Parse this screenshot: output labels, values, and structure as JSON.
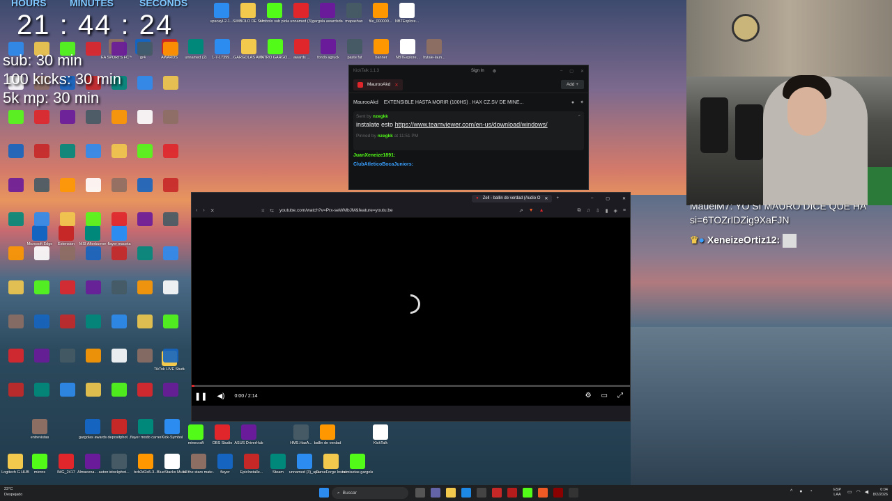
{
  "overlay": {
    "hours_label": "HOURS",
    "minutes_label": "MINUTES",
    "seconds_label": "SECONDS",
    "time": "21 : 44 : 24",
    "goals": [
      "sub: 30 min",
      "100 kicks: 30 min",
      "5k mp: 30 min"
    ]
  },
  "desktop_icons": [
    {
      "label": "upscayl-2-1..."
    },
    {
      "label": "SIMBOLO DE SUB"
    },
    {
      "label": "simbolo sub piola"
    },
    {
      "label": "unnamed (3)"
    },
    {
      "label": "gargola awardsdsdsds"
    },
    {
      "label": "mapashax"
    },
    {
      "label": "file_000000..."
    },
    {
      "label": "NBTExplore..."
    },
    {
      "label": "EA SPORTS FC™ 26"
    },
    {
      "label": "gr4"
    },
    {
      "label": "AWARDS"
    },
    {
      "label": "unnamed (2)"
    },
    {
      "label": "1-7-17399..."
    },
    {
      "label": "GARGOLAS AWARDS ..."
    },
    {
      "label": "INTRO GARGO..."
    },
    {
      "label": "awards ..."
    },
    {
      "label": "fondo agruck"
    },
    {
      "label": "paste fut"
    },
    {
      "label": "banner"
    },
    {
      "label": "NBTExplore..."
    },
    {
      "label": "hytale-laun..."
    },
    {
      "label": "Microsoft Edge"
    },
    {
      "label": "Extension"
    },
    {
      "label": "MSI Afterburner"
    },
    {
      "label": "flayer maceta"
    },
    {
      "label": "TikTok LIVE Studio"
    },
    {
      "label": "minecraft"
    },
    {
      "label": "OBS Studio"
    },
    {
      "label": "ASUS DriverHub"
    },
    {
      "label": "HMS.HasA..."
    },
    {
      "label": "ballin de verdad"
    },
    {
      "label": "KickTalk"
    },
    {
      "label": "entrevistas"
    },
    {
      "label": "gargolas awards"
    },
    {
      "label": "depositphot..."
    },
    {
      "label": "flayer modo carrera"
    },
    {
      "label": "Kick-Symbol"
    },
    {
      "label": "Logitech G HUB"
    },
    {
      "label": "micros"
    },
    {
      "label": "IMG_2417"
    },
    {
      "label": "Almacena... automatic..."
    },
    {
      "label": "istockphot..."
    },
    {
      "label": "bcb2d2a5-3..."
    },
    {
      "label": "BlueStacks Multi-Insta..."
    },
    {
      "label": "all the stars mate atd"
    },
    {
      "label": "flayer"
    },
    {
      "label": "EpicInstalle..."
    },
    {
      "label": "Steam"
    },
    {
      "label": "unnamed (3)_upscayl..."
    },
    {
      "label": "CurseForge Installer"
    },
    {
      "label": "camisetas gargolas"
    }
  ],
  "kicktalk": {
    "title": "KickTalk 1.1.3",
    "sign_in": "Sign In",
    "tab_name": "MaurooAkd",
    "add_label": "Add",
    "channel": "MaurooAkd",
    "stream_title": "EXTENSIBLE HASTA MORIR (100HS) . HAX CZ.SV DE MINE...",
    "sent_by_prefix": "Sent by",
    "sender": "nzegkk",
    "message_prefix": "instalate esto",
    "message_link": "https://www.teamviewer.com/en-us/download/windows/",
    "pinned_by_prefix": "Pinned by",
    "pinned_by": "nzegkk",
    "pinned_at": "at 11:51 PM",
    "chat_users": [
      "JuanXeneize1891:",
      "ClubAtleticoBocaJuniors:"
    ]
  },
  "browser": {
    "tab_title": "Zell - ballin de verdad (Audio O",
    "url": "youtube.com/watch?v=Prx-seWMbJM&feature=youtu.be",
    "time_display": "0:00 / 2:14",
    "progress": 0.0
  },
  "stream_chat": {
    "line1": "MauelM7: YO SI MAURO DICE QUE HA",
    "line2": "si=6TOZrIDZig9XaFJN",
    "line3_user": "XeneizeOrtiz12:"
  },
  "taskbar": {
    "search_placeholder": "Buscar",
    "weather_temp": "23°C",
    "weather_desc": "Despejado",
    "lang": "ESP",
    "lang2": "LAA",
    "clock_time": "0:04",
    "clock_date": "8/2/2026"
  },
  "colors": {
    "kick_green": "#53fc18",
    "accent_red": "#e0262b"
  }
}
